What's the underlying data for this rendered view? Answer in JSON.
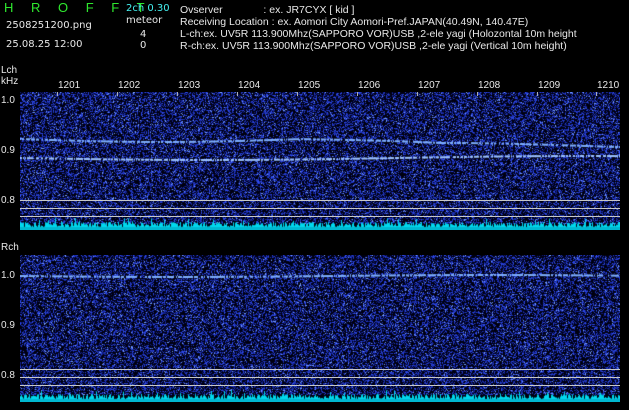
{
  "header": {
    "app_title": "H R O F F T",
    "channel_info": "2ch 0.30",
    "meteor_label": "meteor",
    "filename": "2508251200.png",
    "timestamp": "25.08.25 12:00",
    "count_lch": "4",
    "count_rch": "0",
    "observer_line": "Ovserver              : ex. JR7CYX [ kid ]",
    "location_line": "Receiving Location : ex. Aomori City Aomori-Pref.JAPAN(40.49N, 140.47E)",
    "lch_line": "L-ch:ex. UV5R 113.900Mhz(SAPPORO VOR)USB ,2-ele yagi (Holozontal 10m height",
    "rch_line": "R-ch:ex. UV5R 113.900Mhz(SAPPORO VOR)USB ,2-ele yagi (Vertical 10m height)"
  },
  "lch_panel": {
    "channel_label": "Lch",
    "unit_label": "kHz",
    "y_ticks": [
      "1.0",
      "0.9",
      "0.8"
    ],
    "time_ticks": [
      "1201",
      "1202",
      "1203",
      "1204",
      "1205",
      "1206",
      "1207",
      "1208",
      "1209",
      "1210"
    ]
  },
  "rch_panel": {
    "channel_label": "Rch",
    "y_ticks": [
      "1.0",
      "0.9",
      "0.8"
    ]
  },
  "colors": {
    "background": "#000000",
    "noise_blue": "#2a3cc8",
    "signal_trace": "#8ab8ff",
    "level_bar": "#00e0f0",
    "title_green": "#2ee82e"
  }
}
